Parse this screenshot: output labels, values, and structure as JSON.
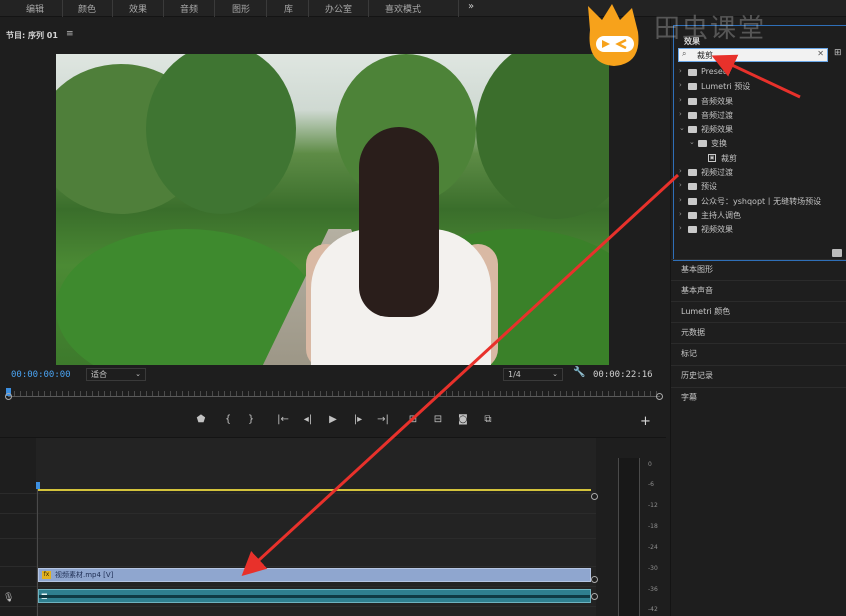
{
  "topbar": {
    "tabs": [
      "编辑",
      "颜色",
      "效果",
      "音频",
      "图形",
      "库",
      "办公室",
      "喜欢模式"
    ],
    "more_icon": "chevron-double-right"
  },
  "monitor": {
    "title": "节目: 序列 01",
    "menu_icon": "hamburger",
    "timecode_current": "00:00:00:00",
    "fit": "适合",
    "resolution": "1/4",
    "timecode_duration": "00:00:22:16",
    "transport": [
      "marker",
      "in-point",
      "out-point",
      "go-to-in",
      "step-back",
      "play",
      "step-forward",
      "go-to-out",
      "insert",
      "overwrite",
      "export-frame",
      "comparison"
    ]
  },
  "effects": {
    "title": "效果",
    "search_value": "裁剪",
    "tree": [
      {
        "label": "Presets",
        "indent": 0,
        "kind": "folder-star",
        "arrow": "›"
      },
      {
        "label": "Lumetri 预设",
        "indent": 0,
        "kind": "folder-star",
        "arrow": "›"
      },
      {
        "label": "音频效果",
        "indent": 0,
        "kind": "folder",
        "arrow": "›"
      },
      {
        "label": "音频过渡",
        "indent": 0,
        "kind": "folder",
        "arrow": "›"
      },
      {
        "label": "视频效果",
        "indent": 0,
        "kind": "folder",
        "arrow": "⌄"
      },
      {
        "label": "变换",
        "indent": 1,
        "kind": "folder",
        "arrow": "⌄"
      },
      {
        "label": "裁剪",
        "indent": 2,
        "kind": "effect",
        "arrow": ""
      },
      {
        "label": "视频过渡",
        "indent": 0,
        "kind": "folder",
        "arrow": "›"
      },
      {
        "label": "预设",
        "indent": 0,
        "kind": "folder",
        "arrow": "›"
      },
      {
        "label": "公众号：yshqopt丨无缝转场预设",
        "indent": 0,
        "kind": "folder-star",
        "arrow": "›"
      },
      {
        "label": "主持人调色",
        "indent": 0,
        "kind": "folder",
        "arrow": "›"
      },
      {
        "label": "视频效果",
        "indent": 0,
        "kind": "folder",
        "arrow": "›"
      }
    ]
  },
  "side_panels": [
    "基本图形",
    "基本声音",
    "Lumetri 颜色",
    "元数据",
    "标记",
    "历史记录",
    "字幕"
  ],
  "timeline": {
    "clip_video_name": "视频素材.mp4 [V]",
    "meter_labels": [
      "0",
      "-6",
      "-12",
      "-18",
      "-24",
      "-30",
      "-36",
      "-42"
    ]
  },
  "overlay": {
    "watermark": "田虫课堂"
  },
  "colors": {
    "accent_blue": "#3d8fe0",
    "arrow_red": "#e8312b",
    "logo_orange": "#f7a21b",
    "clip_video": "#8fa6cf",
    "clip_audio": "#2f7f8f"
  }
}
